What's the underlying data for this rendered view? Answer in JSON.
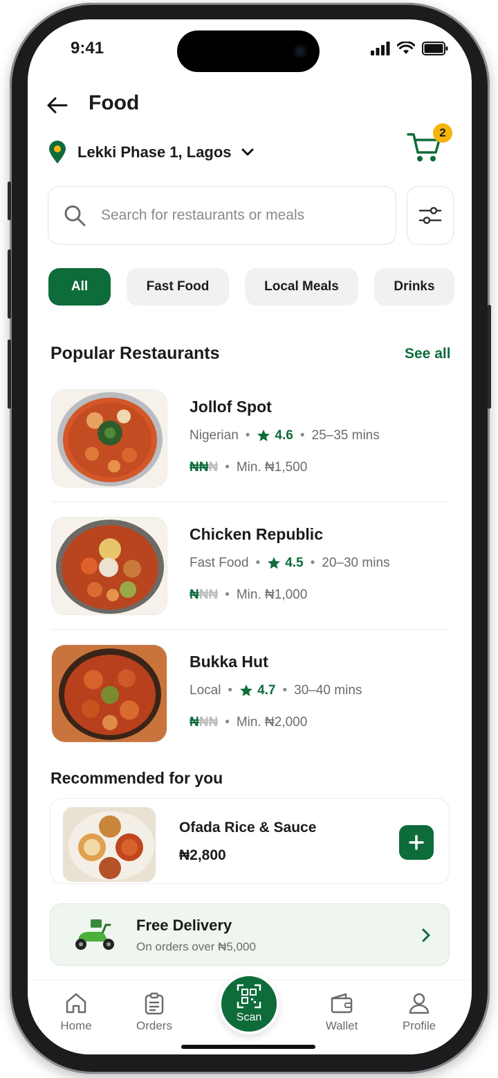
{
  "status_bar": {
    "time": "9:41"
  },
  "header": {
    "title": "Food"
  },
  "location": {
    "label": "Lekki Phase 1, Lagos"
  },
  "cart": {
    "count": "2"
  },
  "search": {
    "placeholder": "Search for restaurants or meals"
  },
  "categories": [
    {
      "label": "All",
      "active": true
    },
    {
      "label": "Fast Food",
      "active": false
    },
    {
      "label": "Local Meals",
      "active": false
    },
    {
      "label": "Drinks",
      "active": false
    }
  ],
  "popular": {
    "title": "Popular Restaurants",
    "see_all": "See all",
    "restaurants": [
      {
        "name": "Jollof Spot",
        "cuisine": "Nigerian",
        "rating": "4.6",
        "time": "25–35 mins",
        "price_on": "₦₦",
        "price_off": "₦",
        "min_order": "Min. ₦1,500"
      },
      {
        "name": "Chicken Republic",
        "cuisine": "Fast Food",
        "rating": "4.5",
        "time": "20–30 mins",
        "price_on": "₦",
        "price_off": "₦₦",
        "min_order": "Min. ₦1,000"
      },
      {
        "name": "Bukka Hut",
        "cuisine": "Local",
        "rating": "4.7",
        "time": "30–40 mins",
        "price_on": "₦",
        "price_off": "₦₦",
        "min_order": "Min. ₦2,000"
      }
    ]
  },
  "recommended": {
    "title": "Recommended for you",
    "item": {
      "name": "Ofada Rice & Sauce",
      "price": "₦2,800"
    }
  },
  "promo": {
    "title": "Free Delivery",
    "subtitle": "On orders over ₦5,000"
  },
  "tabbar": {
    "home": "Home",
    "orders": "Orders",
    "scan": "Scan",
    "wallet": "Wallet",
    "profile": "Profile"
  },
  "colors": {
    "brand_green": "#0e6b3a",
    "badge_yellow": "#f5b50c",
    "chip_gray": "#f1f1f1"
  }
}
